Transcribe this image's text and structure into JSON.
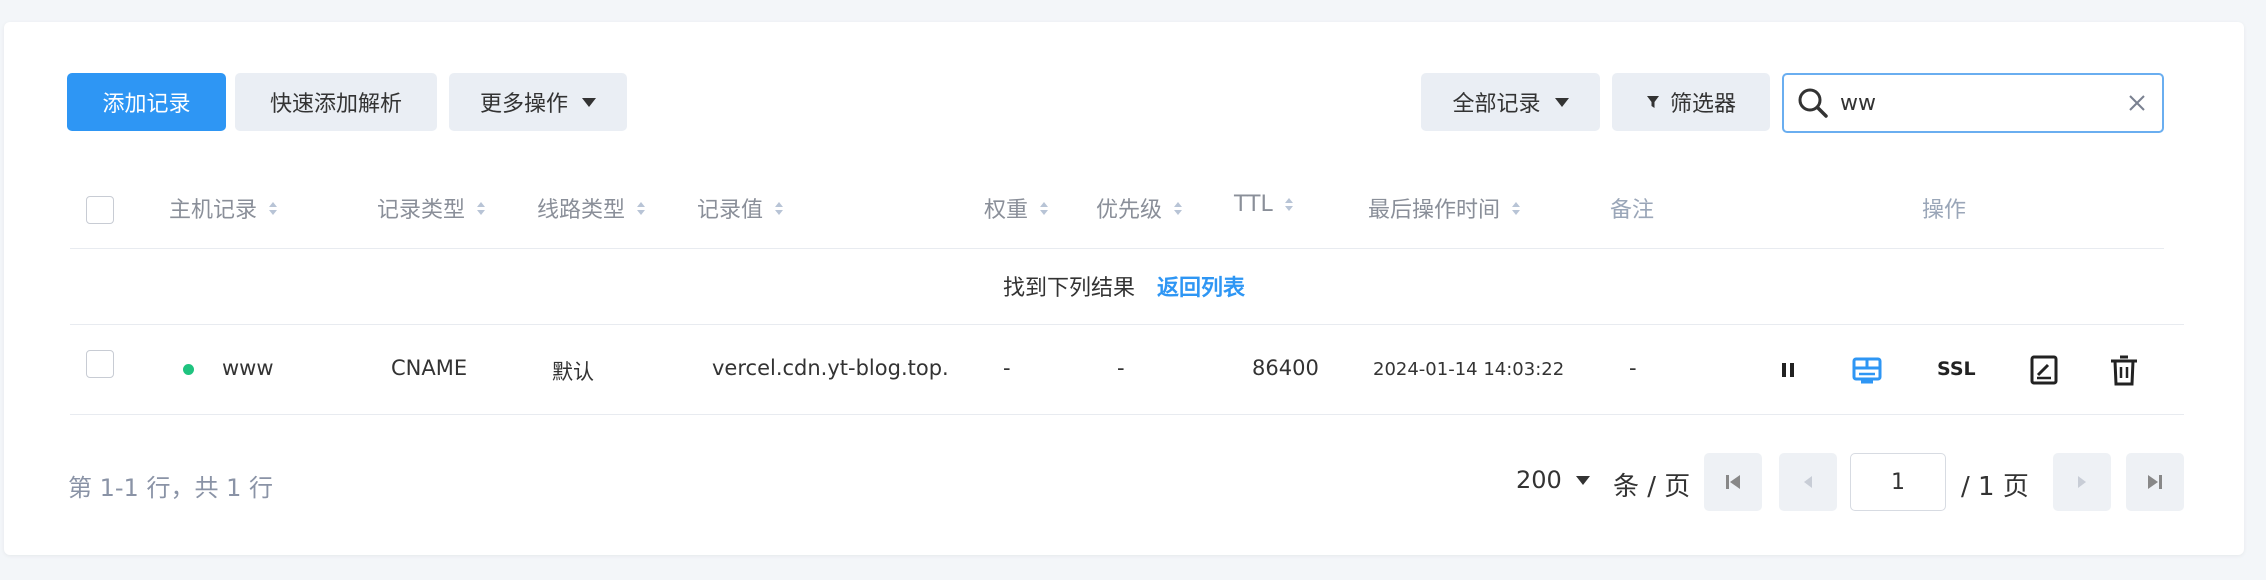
{
  "toolbar": {
    "add_record": "添加记录",
    "quick_add": "快速添加解析",
    "more_actions": "更多操作",
    "all_records": "全部记录",
    "filter": "筛选器"
  },
  "search": {
    "value": "ww",
    "placeholder": ""
  },
  "columns": [
    "主机记录",
    "记录类型",
    "线路类型",
    "记录值",
    "权重",
    "优先级",
    "TTL",
    "最后操作时间",
    "备注",
    "操作"
  ],
  "result_bar": {
    "text": "找到下列结果",
    "back_link": "返回列表"
  },
  "rows": [
    {
      "status_color": "#1fc37f",
      "host": "www",
      "type": "CNAME",
      "line": "默认",
      "value": "vercel.cdn.yt-blog.top.",
      "weight": "-",
      "priority": "-",
      "ttl": "86400",
      "last_modified": "2024-01-14 14:03:22",
      "remark": "-",
      "ssl_label": "SSL"
    }
  ],
  "footer": {
    "summary": "第 1-1 行，共 1 行",
    "page_size": "200",
    "per_page_label": "条 / 页",
    "current_page": "1",
    "total_pages_label": "/ 1 页"
  },
  "colors": {
    "accent": "#2e96f4",
    "status_active": "#1fc37f"
  }
}
